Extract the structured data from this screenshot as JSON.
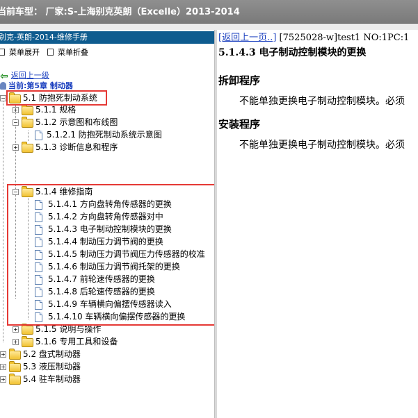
{
  "window": {
    "title": "当前车型：  厂家:S-上海别克英朗（Excelle）2013-2014"
  },
  "left": {
    "book_title": "别克-英朗-2014-维修手册",
    "expand_label": "菜单展开",
    "collapse_label": "菜单折叠",
    "back_label": "返回上一级",
    "current_label": "当前:第5章 制动器"
  },
  "tree": {
    "n1": "5.1 防抱死制动系统",
    "n2": "5.1.1 规格",
    "n3": "5.1.2 示意图和布线图",
    "n4": "5.1.2.1 防抱死制动系统示意图",
    "n5": "5.1.3 诊断信息和程序",
    "n6": "5.1.4 维修指南",
    "n7": "5.1.4.1 方向盘转角传感器的更换",
    "n8": "5.1.4.2 方向盘转角传感器对中",
    "n9": "5.1.4.3 电子制动控制模块的更换",
    "n10": "5.1.4.4 制动压力调节阀的更换",
    "n11": "5.1.4.5 制动压力调节阀压力传感器的校准",
    "n12": "5.1.4.6 制动压力调节阀托架的更换",
    "n13": "5.1.4.7 前轮速传感器的更换",
    "n14": "5.1.4.8 后轮速传感器的更换",
    "n15": "5.1.4.9 车辆横向偏摆传感器读入",
    "n16": "5.1.4.10 车辆横向偏摆传感器的更换",
    "n17": "5.1.5 说明与操作",
    "n18": "5.1.6 专用工具和设备",
    "n19": "5.2 盘式制动器",
    "n20": "5.3 液压制动器",
    "n21": "5.4 驻车制动器"
  },
  "right": {
    "nav_link": "[返回上一页..]",
    "nav_info": " [7525028-w]test1 NO:1PC:1",
    "doc_title": "5.1.4.3 电子制动控制模块的更换",
    "sec1": "拆卸程序",
    "para1": "不能单独更换电子制动控制模块。必须",
    "sec2": "安装程序",
    "para2": "不能单独更换电子制动控制模块。必须"
  },
  "colors": {
    "highlight": "#e53935",
    "link": "#1a3fbf",
    "title_bar": "#0f5c8f"
  }
}
